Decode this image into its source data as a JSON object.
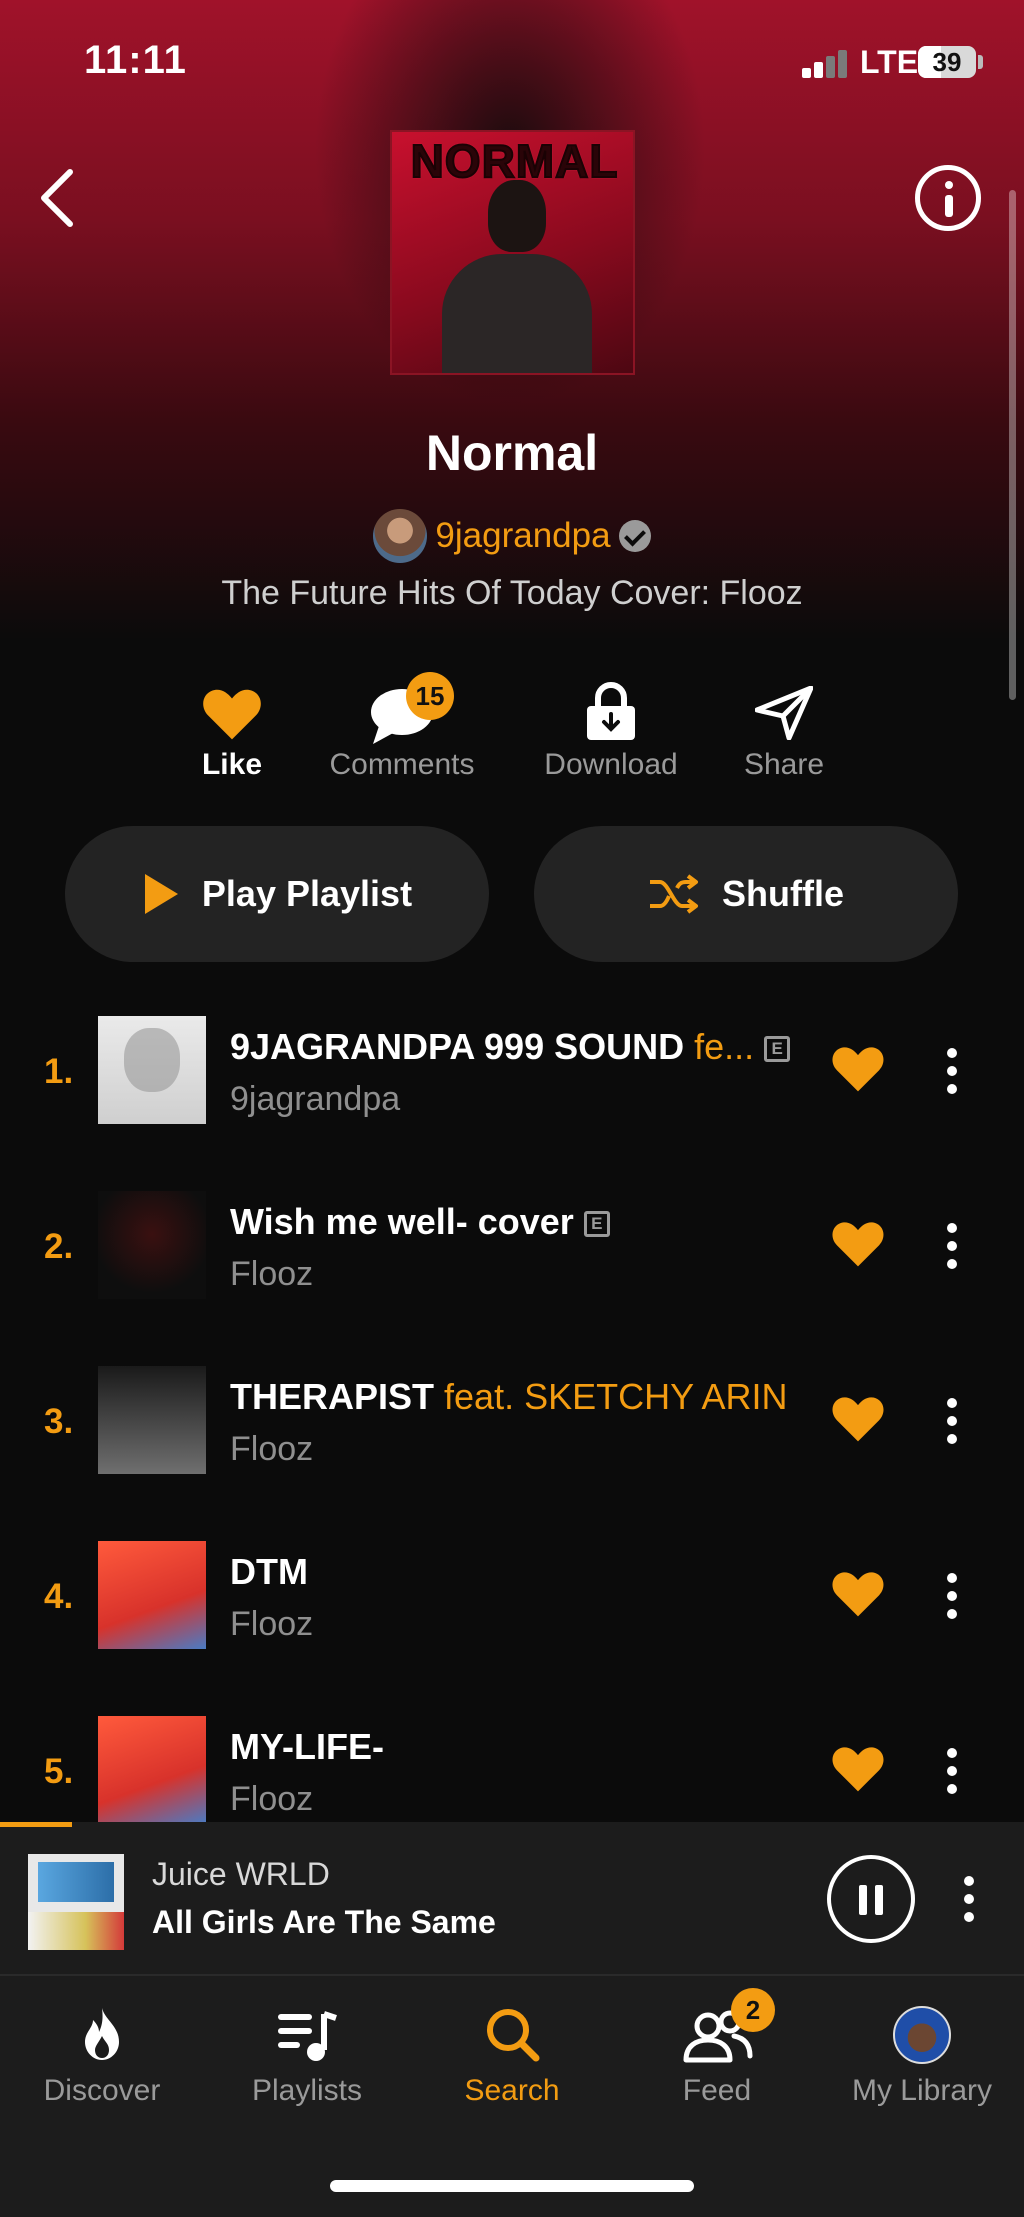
{
  "status_bar": {
    "time": "11:11",
    "network": "LTE",
    "battery": "39"
  },
  "playlist": {
    "cover_text": "NORMAL",
    "title": "Normal",
    "owner": "9jagrandpa",
    "description": "The Future Hits Of Today Cover: Flooz"
  },
  "actions": {
    "like": "Like",
    "comments": "Comments",
    "comments_count": "15",
    "download": "Download",
    "share": "Share"
  },
  "buttons": {
    "play": "Play Playlist",
    "shuffle": "Shuffle"
  },
  "tracks": [
    {
      "num": "1.",
      "title": "9JAGRANDPA 999 SOUND",
      "feat": " fe...",
      "explicit": "E",
      "artist": "9jagrandpa"
    },
    {
      "num": "2.",
      "title": "Wish me well- cover",
      "feat": "",
      "explicit": "E",
      "artist": "Flooz"
    },
    {
      "num": "3.",
      "title": "THERAPIST",
      "feat": " feat. SKETCHY ARIN",
      "explicit": "",
      "artist": "Flooz"
    },
    {
      "num": "4.",
      "title": "DTM",
      "feat": "",
      "explicit": "",
      "artist": "Flooz"
    },
    {
      "num": "5.",
      "title": "MY-LIFE-",
      "feat": "",
      "explicit": "",
      "artist": "Flooz"
    }
  ],
  "now_playing": {
    "artist": "Juice WRLD",
    "title": "All Girls Are The Same",
    "progress": 0.07
  },
  "tabs": [
    {
      "label": "Discover"
    },
    {
      "label": "Playlists"
    },
    {
      "label": "Search"
    },
    {
      "label": "Feed",
      "badge": "2"
    },
    {
      "label": "My Library"
    }
  ],
  "colors": {
    "accent": "#f39c12",
    "hero": "#a0122a",
    "surface": "#232323"
  }
}
